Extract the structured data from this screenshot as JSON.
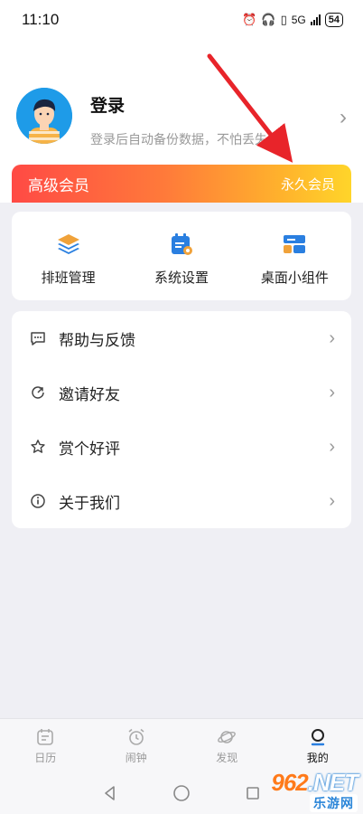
{
  "status_bar": {
    "time": "11:10",
    "network": "5G",
    "battery": "54"
  },
  "profile": {
    "title": "登录",
    "subtitle": "登录后自动备份数据，不怕丢失"
  },
  "vip": {
    "title": "高级会员",
    "badge": "永久会员"
  },
  "quick_actions": [
    {
      "label": "排班管理",
      "icon": "layers-icon"
    },
    {
      "label": "系统设置",
      "icon": "calendar-gear-icon"
    },
    {
      "label": "桌面小组件",
      "icon": "widget-icon"
    }
  ],
  "menu": [
    {
      "label": "帮助与反馈",
      "icon": "chat-bubble-icon"
    },
    {
      "label": "邀请好友",
      "icon": "share-circle-icon"
    },
    {
      "label": "赏个好评",
      "icon": "star-icon"
    },
    {
      "label": "关于我们",
      "icon": "info-icon"
    }
  ],
  "tabs": [
    {
      "label": "日历",
      "icon": "calendar-icon"
    },
    {
      "label": "闹钟",
      "icon": "alarm-clock-icon"
    },
    {
      "label": "发现",
      "icon": "planet-icon"
    },
    {
      "label": "我的",
      "icon": "user-icon",
      "active": true
    }
  ],
  "watermark": {
    "logo_num": "962",
    "logo_suffix": ".NET",
    "sub": "乐游网"
  },
  "colors": {
    "accent_blue": "#2a7fe0",
    "vip_start": "#ff4a45",
    "vip_end": "#ffd52a",
    "arrow": "#e8242a"
  }
}
